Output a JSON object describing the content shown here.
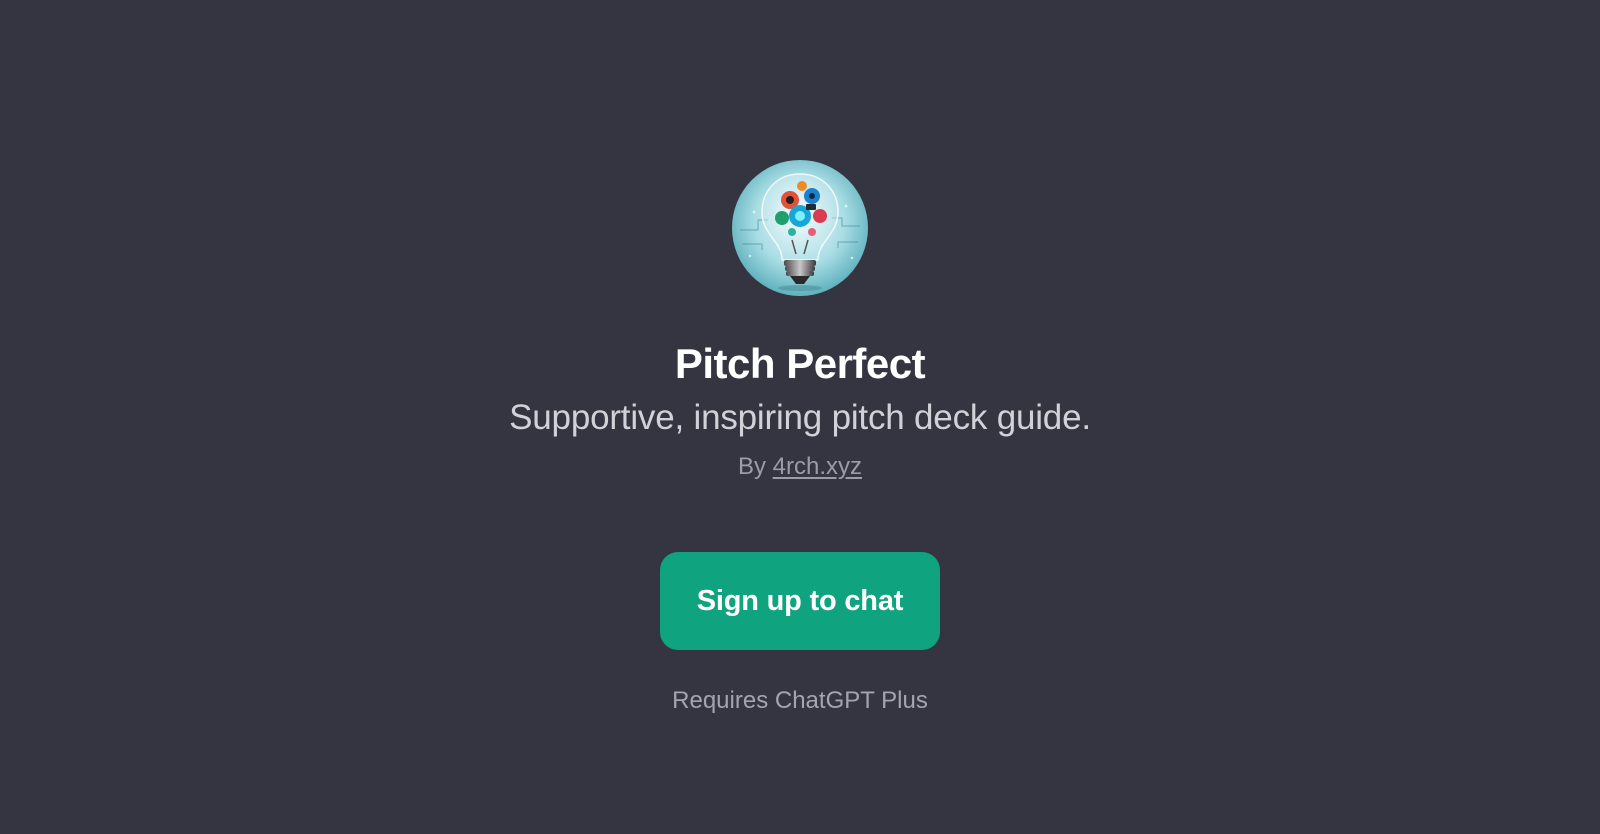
{
  "gpt": {
    "name": "Pitch Perfect",
    "description": "Supportive, inspiring pitch deck guide.",
    "byline_prefix": "By",
    "author": "4rch.xyz",
    "avatar_icon": "lightbulb-icon"
  },
  "actions": {
    "signup_label": "Sign up to chat"
  },
  "footer": {
    "requirement": "Requires ChatGPT Plus"
  },
  "colors": {
    "background": "#343541",
    "accent": "#10a37f"
  }
}
